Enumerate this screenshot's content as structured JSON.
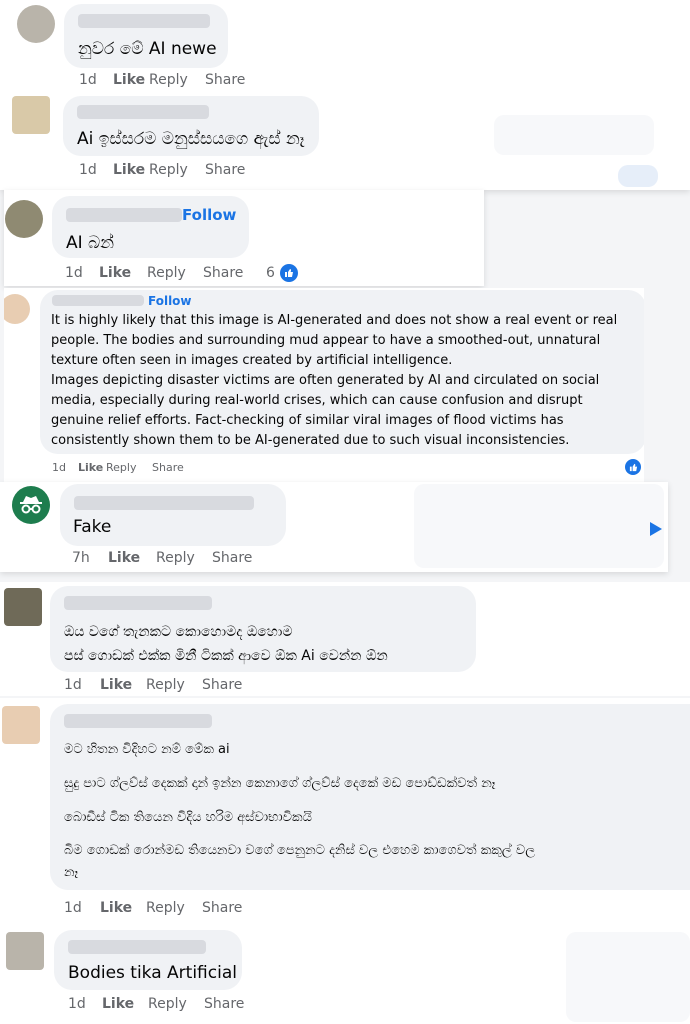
{
  "comments": [
    {
      "text": "නුවර මේ AI newe",
      "actions": {
        "time": "1d",
        "like": "Like",
        "reply": "Reply",
        "share": "Share"
      }
    },
    {
      "text": "Ai ඉස්සරම මනුස්සයගෙ ඇස් නෑ",
      "actions": {
        "time": "1d",
        "like": "Like",
        "reply": "Reply",
        "share": "Share"
      }
    },
    {
      "follow": "Follow",
      "text": "AI බන්",
      "actions": {
        "time": "1d",
        "like": "Like",
        "reply": "Reply",
        "share": "Share"
      },
      "reaction_count": "6"
    },
    {
      "follow": "Follow",
      "lines": [
        "It is highly likely that this image is AI-generated and does not show a real event or real",
        "people. The bodies and surrounding mud appear to have a smoothed-out, unnatural",
        "texture often seen in images created by artificial intelligence.",
        "Images depicting disaster victims are often generated by AI and circulated on social",
        "media, especially during real-world crises, which can cause confusion and disrupt",
        "genuine relief efforts. Fact-checking of similar viral images of flood victims has",
        "consistently shown them to be AI-generated due to such visual inconsistencies."
      ],
      "actions": {
        "time": "1d",
        "like": "Like",
        "reply": "Reply",
        "share": "Share"
      }
    },
    {
      "text": "Fake",
      "actions": {
        "time": "7h",
        "like": "Like",
        "reply": "Reply",
        "share": "Share"
      }
    },
    {
      "lines": [
        "ඔය වගේ තැනකට කොහොමද ඔහොම",
        "පස් ගොඩක් එක්ක මිනී ටිකක් ආවෙ ඕක Ai වෙන්න ඕන"
      ],
      "actions": {
        "time": "1d",
        "like": "Like",
        "reply": "Reply",
        "share": "Share"
      }
    },
    {
      "lines": [
        "මට හිතන විදිහට නම් මේක ai",
        "සුදු පාට ග්ලව්ස් දෙකක් දාන් ඉන්න කෙනාගේ ග්ලව්ස් දෙකේ මඩ පොඩ්ඩක්වත් නෑ",
        "බොඩීස් ටික තියෙන විදිය හරිම අස්වාභාවිකයි",
        "බිම ගොඩක් රොන්මඩ තියෙනවා වගේ පෙනුනට දනිස් වල එහෙම කාගෙවත් කකුල් වල",
        "නෑ"
      ],
      "actions": {
        "time": "1d",
        "like": "Like",
        "reply": "Reply",
        "share": "Share"
      }
    },
    {
      "text": "Bodies tika Artificial",
      "actions": {
        "time": "1d",
        "like": "Like",
        "reply": "Reply",
        "share": "Share"
      }
    }
  ],
  "colors": {
    "accent": "#1b74e4",
    "bubble": "#f0f2f5",
    "meta": "#65676b"
  }
}
